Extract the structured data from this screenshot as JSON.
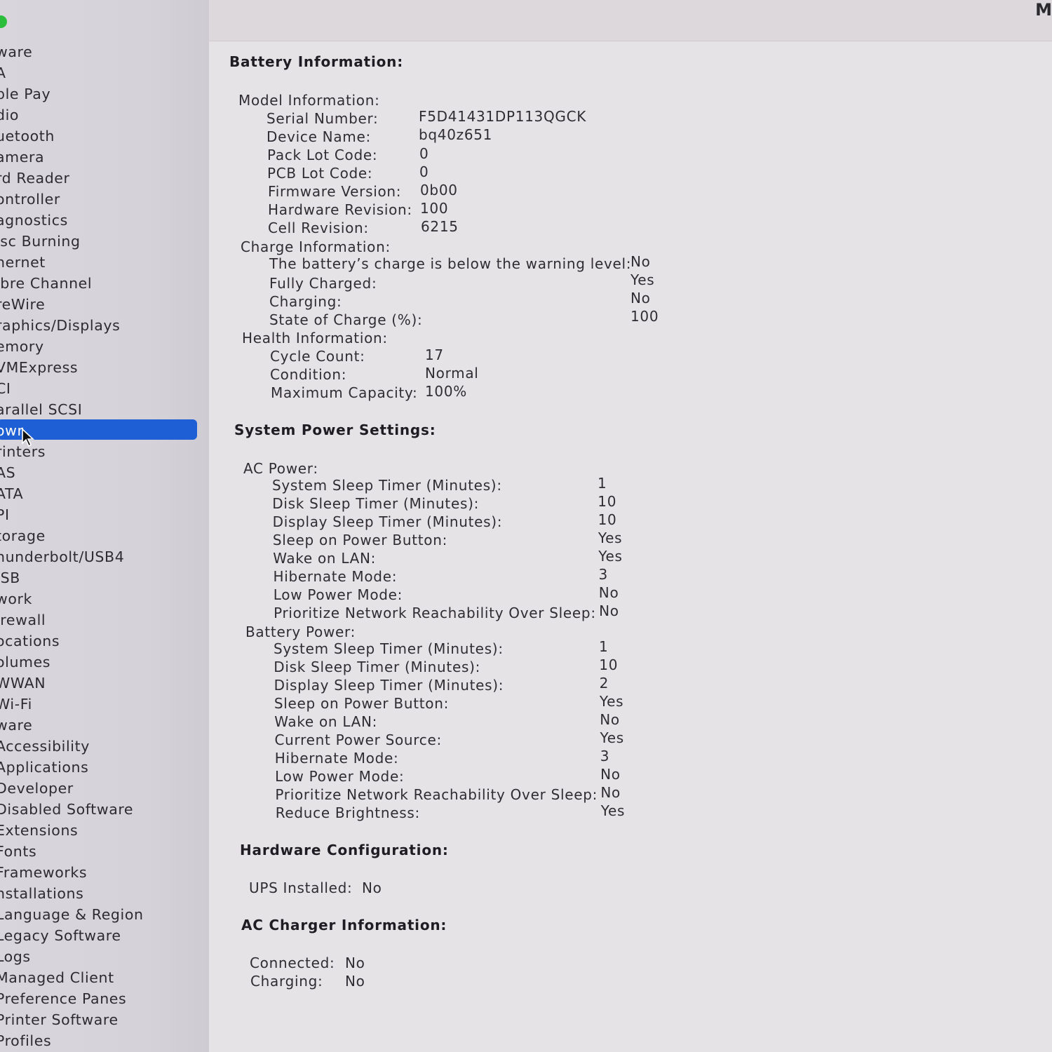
{
  "sidebar": {
    "items": [
      "ware",
      "A",
      "ple Pay",
      "dio",
      "uetooth",
      "amera",
      "rd Reader",
      "ontroller",
      "agnostics",
      "isc Burning",
      "hernet",
      "ibre Channel",
      "reWire",
      "raphics/Displays",
      "emory",
      "VMExpress",
      "CI",
      "arallel SCSI",
      "owr",
      "rinters",
      "AS",
      "ATA",
      "PI",
      "torage",
      "hunderbolt/USB4",
      "JSB",
      "work",
      "irewall",
      "ocations",
      "olumes",
      "WWAN",
      "Wi-Fi",
      "ware",
      "Accessibility",
      "Applications",
      "Developer",
      "Disabled Software",
      "Extensions",
      "Fonts",
      "Frameworks",
      "nstallations",
      "Language & Region",
      "Legacy Software",
      "Logs",
      "Managed Client",
      "Preference Panes",
      "Printer Software",
      "Profiles"
    ],
    "selected_index": 18
  },
  "toolbar": {
    "corner_letter": "M"
  },
  "battery": {
    "title": "Battery Information:",
    "model": {
      "label": "Model Information:",
      "serial_label": "Serial Number:",
      "serial": "F5D41431DP113QGCK",
      "device_label": "Device Name:",
      "device": "bq40z651",
      "pack_label": "Pack Lot Code:",
      "pack": "0",
      "pcb_label": "PCB Lot Code:",
      "pcb": "0",
      "firmware_label": "Firmware Version:",
      "firmware": "0b00",
      "hw_label": "Hardware Revision:",
      "hw": "100",
      "cell_label": "Cell Revision:",
      "cell": "6215"
    },
    "charge": {
      "label": "Charge Information:",
      "warning_label": "The battery’s charge is below the warning level:",
      "warning": "No",
      "full_label": "Fully Charged:",
      "full": "Yes",
      "charging_label": "Charging:",
      "charging": "No",
      "soc_label": "State of Charge (%):",
      "soc": "100"
    },
    "health": {
      "label": "Health Information:",
      "cycle_label": "Cycle Count:",
      "cycle": "17",
      "condition_label": "Condition:",
      "condition": "Normal",
      "max_label": "Maximum Capacity:",
      "max": "100%"
    }
  },
  "power": {
    "title": "System Power Settings:",
    "ac": {
      "label": "AC Power:",
      "rows": [
        {
          "label": "System Sleep Timer (Minutes):",
          "value": "1"
        },
        {
          "label": "Disk Sleep Timer (Minutes):",
          "value": "10"
        },
        {
          "label": "Display Sleep Timer (Minutes):",
          "value": "10"
        },
        {
          "label": "Sleep on Power Button:",
          "value": "Yes"
        },
        {
          "label": "Wake on LAN:",
          "value": "Yes"
        },
        {
          "label": "Hibernate Mode:",
          "value": "3"
        },
        {
          "label": "Low Power Mode:",
          "value": "No"
        },
        {
          "label": "Prioritize Network Reachability Over Sleep:",
          "value": "No"
        }
      ]
    },
    "battery": {
      "label": "Battery Power:",
      "rows": [
        {
          "label": "System Sleep Timer (Minutes):",
          "value": "1"
        },
        {
          "label": "Disk Sleep Timer (Minutes):",
          "value": "10"
        },
        {
          "label": "Display Sleep Timer (Minutes):",
          "value": "2"
        },
        {
          "label": "Sleep on Power Button:",
          "value": "Yes"
        },
        {
          "label": "Wake on LAN:",
          "value": "No"
        },
        {
          "label": "Current Power Source:",
          "value": "Yes"
        },
        {
          "label": "Hibernate Mode:",
          "value": "3"
        },
        {
          "label": "Low Power Mode:",
          "value": "No"
        },
        {
          "label": "Prioritize Network Reachability Over Sleep:",
          "value": "No"
        },
        {
          "label": "Reduce Brightness:",
          "value": "Yes"
        }
      ]
    }
  },
  "hardware": {
    "title": "Hardware Configuration:",
    "ups_label": "UPS Installed:",
    "ups": "No"
  },
  "charger": {
    "title": "AC Charger Information:",
    "connected_label": "Connected:",
    "connected": "No",
    "charging_label": "Charging:",
    "charging": "No"
  }
}
